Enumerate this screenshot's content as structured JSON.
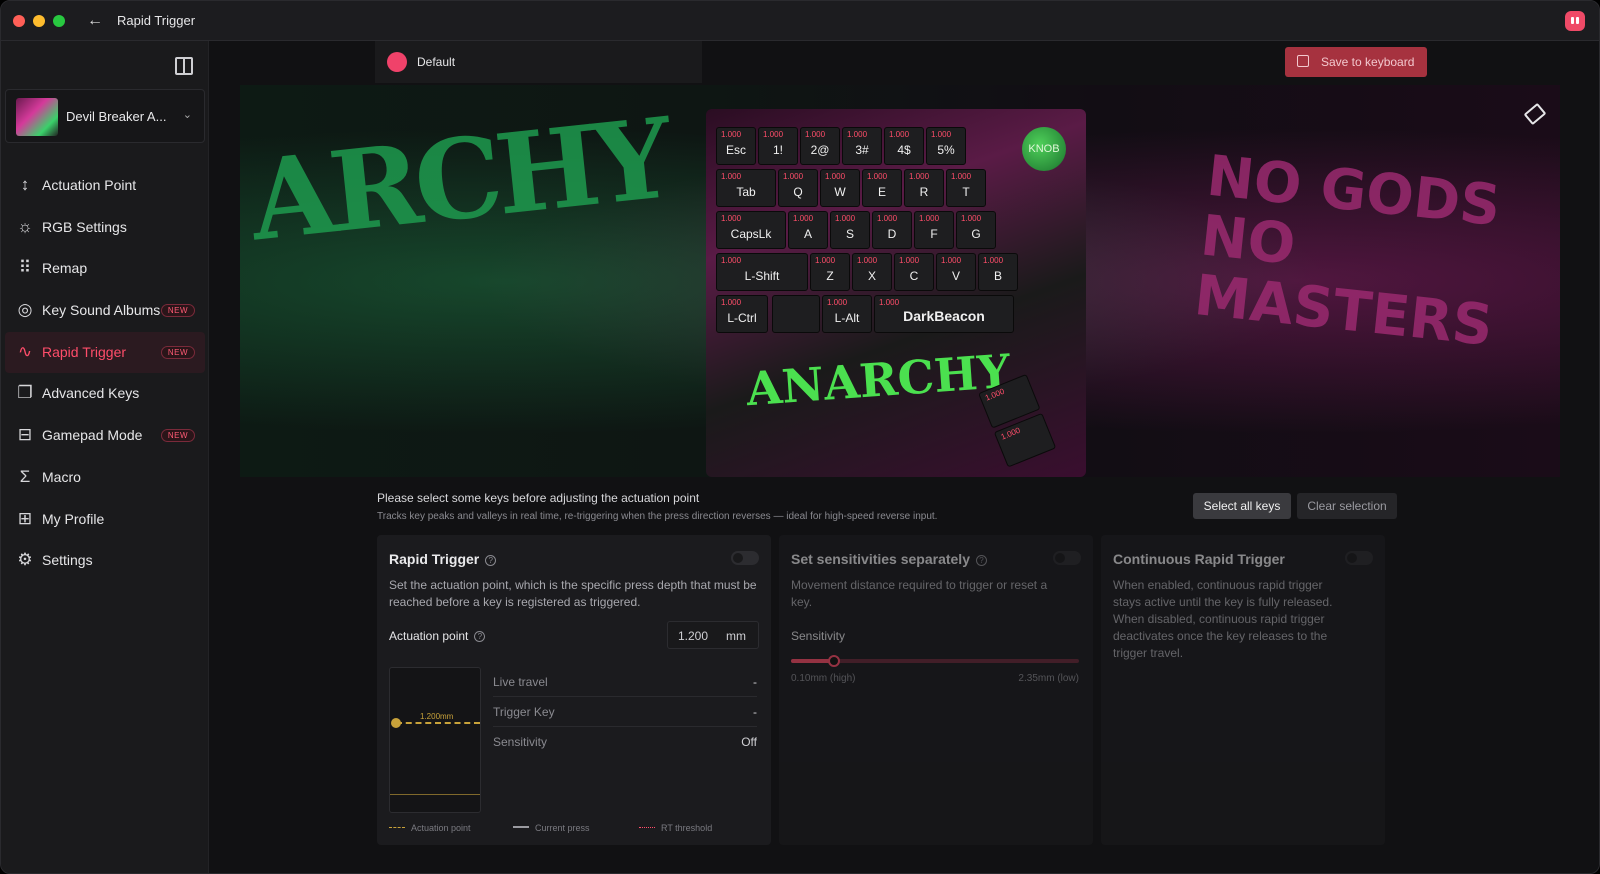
{
  "window": {
    "title": "Rapid Trigger"
  },
  "device": {
    "name": "Devil Breaker A..."
  },
  "nav": [
    {
      "label": "Actuation Point",
      "icon": "actuation-icon",
      "badge": ""
    },
    {
      "label": "RGB Settings",
      "icon": "sun-icon",
      "badge": ""
    },
    {
      "label": "Remap",
      "icon": "keyboard-icon",
      "badge": ""
    },
    {
      "label": "Key Sound Albums",
      "icon": "disc-icon",
      "badge": "NEW"
    },
    {
      "label": "Rapid Trigger",
      "icon": "pulse-icon",
      "badge": "NEW",
      "active": true
    },
    {
      "label": "Advanced Keys",
      "icon": "keys-icon",
      "badge": ""
    },
    {
      "label": "Gamepad Mode",
      "icon": "gamepad-icon",
      "badge": "NEW"
    },
    {
      "label": "Macro",
      "icon": "sigma-icon",
      "badge": ""
    },
    {
      "label": "My Profile",
      "icon": "grid-icon",
      "badge": ""
    },
    {
      "label": "Settings",
      "icon": "gear-icon",
      "badge": ""
    }
  ],
  "profile": {
    "name": "Default",
    "color": "#f0426a"
  },
  "toolbar": {
    "save_label": "Save to keyboard"
  },
  "banner": {
    "art_left": "ARCHY",
    "art_right": "NO GODS NO MASTERS"
  },
  "keyboard": {
    "knob_label": "KNOB",
    "keys": [
      {
        "cap": "Esc",
        "val": "1.000"
      },
      {
        "cap": "1!",
        "val": "1.000"
      },
      {
        "cap": "2@",
        "val": "1.000"
      },
      {
        "cap": "3#",
        "val": "1.000"
      },
      {
        "cap": "4$",
        "val": "1.000"
      },
      {
        "cap": "5%",
        "val": "1.000"
      },
      {
        "cap": "Tab",
        "val": "1.000"
      },
      {
        "cap": "Q",
        "val": "1.000"
      },
      {
        "cap": "W",
        "val": "1.000"
      },
      {
        "cap": "E",
        "val": "1.000"
      },
      {
        "cap": "R",
        "val": "1.000"
      },
      {
        "cap": "T",
        "val": "1.000"
      },
      {
        "cap": "CapsLk",
        "val": "1.000"
      },
      {
        "cap": "A",
        "val": "1.000"
      },
      {
        "cap": "S",
        "val": "1.000"
      },
      {
        "cap": "D",
        "val": "1.000"
      },
      {
        "cap": "F",
        "val": "1.000"
      },
      {
        "cap": "G",
        "val": "1.000"
      },
      {
        "cap": "L-Shift",
        "val": "1.000"
      },
      {
        "cap": "Z",
        "val": "1.000"
      },
      {
        "cap": "X",
        "val": "1.000"
      },
      {
        "cap": "C",
        "val": "1.000"
      },
      {
        "cap": "V",
        "val": "1.000"
      },
      {
        "cap": "B",
        "val": "1.000"
      },
      {
        "cap": "L-Ctrl",
        "val": "1.000"
      },
      {
        "cap": "",
        "val": ""
      },
      {
        "cap": "L-Alt",
        "val": "1.000"
      },
      {
        "cap": "DarkBeacon",
        "val": "1.000"
      }
    ],
    "extra_keys": [
      {
        "val": "1.000"
      },
      {
        "val": "1.000"
      }
    ],
    "art_text": "ANARCHY"
  },
  "hint": {
    "title": "Please select some keys before adjusting the actuation point",
    "subtitle": "Tracks key peaks and valleys in real time, re-triggering when the press direction reverses — ideal for high-speed reverse input."
  },
  "selection": {
    "select_all": "Select all keys",
    "clear": "Clear selection"
  },
  "rapid_trigger": {
    "title": "Rapid Trigger",
    "description": "Set the actuation point, which is the specific press depth that must be reached before a key is registered as triggered.",
    "actuation_label": "Actuation point",
    "actuation_value": "1.200",
    "unit": "mm",
    "marker_label": "1.200mm",
    "stats": [
      {
        "key": "Live travel",
        "value": "-"
      },
      {
        "key": "Trigger Key",
        "value": "-"
      },
      {
        "key": "Sensitivity",
        "value": "Off"
      }
    ],
    "legend": {
      "actuation": "Actuation point",
      "current": "Current press",
      "rt": "RT threshold"
    }
  },
  "sensitivities": {
    "title": "Set sensitivities separately",
    "description": "Movement distance required to trigger or reset a key.",
    "label": "Sensitivity",
    "min_label": "0.10mm (high)",
    "max_label": "2.35mm (low)",
    "value_fraction": 0.15
  },
  "continuous": {
    "title": "Continuous Rapid Trigger",
    "description": "When enabled, continuous rapid trigger stays active until the key is fully released. When disabled, continuous rapid trigger deactivates once the key releases to the trigger travel."
  },
  "colors": {
    "accent": "#ff4d6a",
    "save": "#a6323f",
    "marker": "#c8a23a"
  }
}
